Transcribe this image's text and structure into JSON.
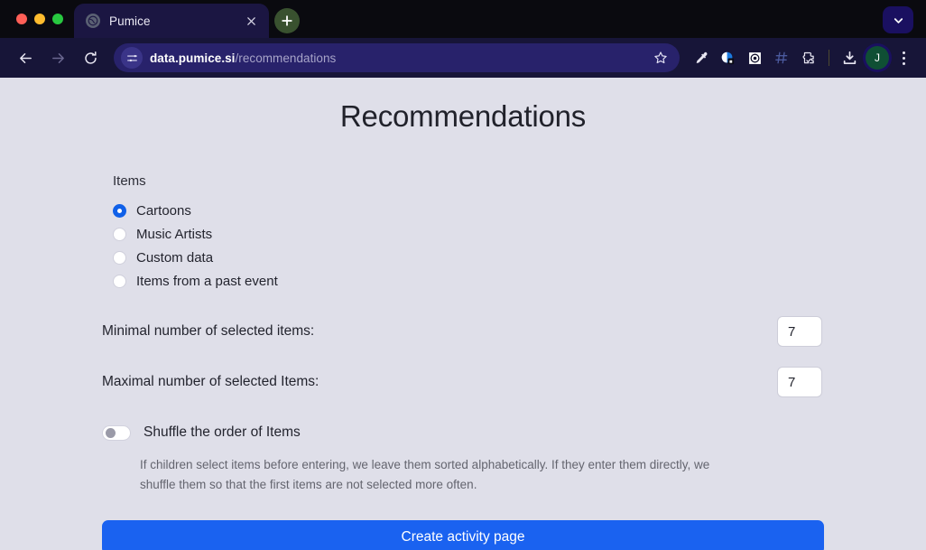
{
  "window": {
    "traffic_lights": [
      "close",
      "minimize",
      "maximize"
    ],
    "menu_icon": "chevron-down-icon"
  },
  "tabs": [
    {
      "title": "Pumice",
      "favicon": "globe-icon",
      "close_icon": "close-icon",
      "active": true
    }
  ],
  "new_tab": {
    "icon": "plus-icon",
    "label": "+"
  },
  "toolbar": {
    "back": {
      "icon": "arrow-left-icon",
      "label": "←"
    },
    "forward": {
      "icon": "arrow-right-icon",
      "label": "→"
    },
    "reload": {
      "icon": "reload-icon",
      "label": "↻"
    },
    "site_info_icon": "site-settings-icon",
    "url_domain": "data.pumice.si",
    "url_path": "/recommendations",
    "bookmark_icon": "star-icon",
    "extensions": [
      {
        "icon": "eyedropper-icon",
        "name": "color-picker-extension"
      },
      {
        "icon": "privacy-badger-icon",
        "name": "privacy-extension"
      },
      {
        "icon": "target-icon",
        "name": "recorder-extension"
      },
      {
        "icon": "hashtag-icon",
        "name": "hashtag-extension"
      },
      {
        "icon": "puzzle-check-icon",
        "name": "extensions-button"
      }
    ],
    "download_icon": "download-icon",
    "avatar_initial": "J",
    "menu_icon": "kebab-menu-icon"
  },
  "page": {
    "title": "Recommendations",
    "items_group": {
      "label": "Items",
      "options": [
        {
          "label": "Cartoons",
          "selected": true
        },
        {
          "label": "Music Artists",
          "selected": false
        },
        {
          "label": "Custom data",
          "selected": false
        },
        {
          "label": "Items from a past event",
          "selected": false
        }
      ]
    },
    "minimal": {
      "label": "Minimal number of selected items:",
      "value": "7",
      "placeholder": ""
    },
    "maximal": {
      "label": "Maximal number of selected Items:",
      "value": "7",
      "placeholder": ""
    },
    "shuffle": {
      "label": "Shuffle the order of Items",
      "enabled": false,
      "help_text": "If children select items before entering, we leave them sorted alphabetically. If they enter them directly, we shuffle them so that the first items are not selected more often."
    },
    "submit_label": "Create activity page"
  },
  "colors": {
    "page_bg": "#dfdfe9",
    "toolbar_bg": "#171538",
    "omnibox_bg": "#28226b",
    "tab_bg": "#1b1642",
    "accent_blue": "#1a62f0",
    "radio_blue": "#1060e8",
    "new_tab_green": "#39512f",
    "avatar_green": "#0f4f34"
  }
}
